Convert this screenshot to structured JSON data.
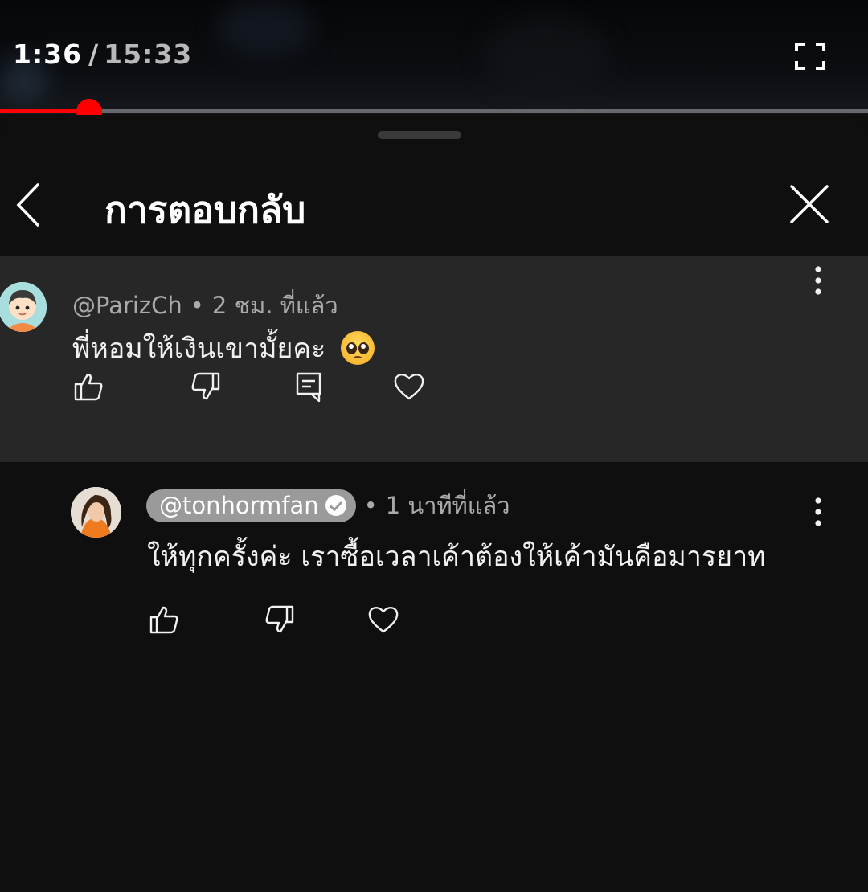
{
  "player": {
    "current_time": "1:36",
    "separator": "/",
    "duration": "15:33",
    "progress_fraction": 0.103
  },
  "panel": {
    "title": "การตอบกลับ"
  },
  "parent_comment": {
    "author": "@ParizCh",
    "timestamp": "2 ชม. ที่แล้ว",
    "text": "พี่หอมให้เงินเขามั้ยคะ",
    "emoji": "pleading-face"
  },
  "reply": {
    "author": "@tonhormfan",
    "verified": true,
    "timestamp": "1 นาทีที่แล้ว",
    "text": "ให้ทุกครั้งค่ะ เราซื้อเวลาเค้าต้องให้เค้ามันคือมารยาท"
  },
  "colors": {
    "accent": "#ff0000",
    "background": "#0f0f0f",
    "highlight": "#272727",
    "secondary_text": "#aaaaaa",
    "author_pill": "#9a9a9a"
  }
}
